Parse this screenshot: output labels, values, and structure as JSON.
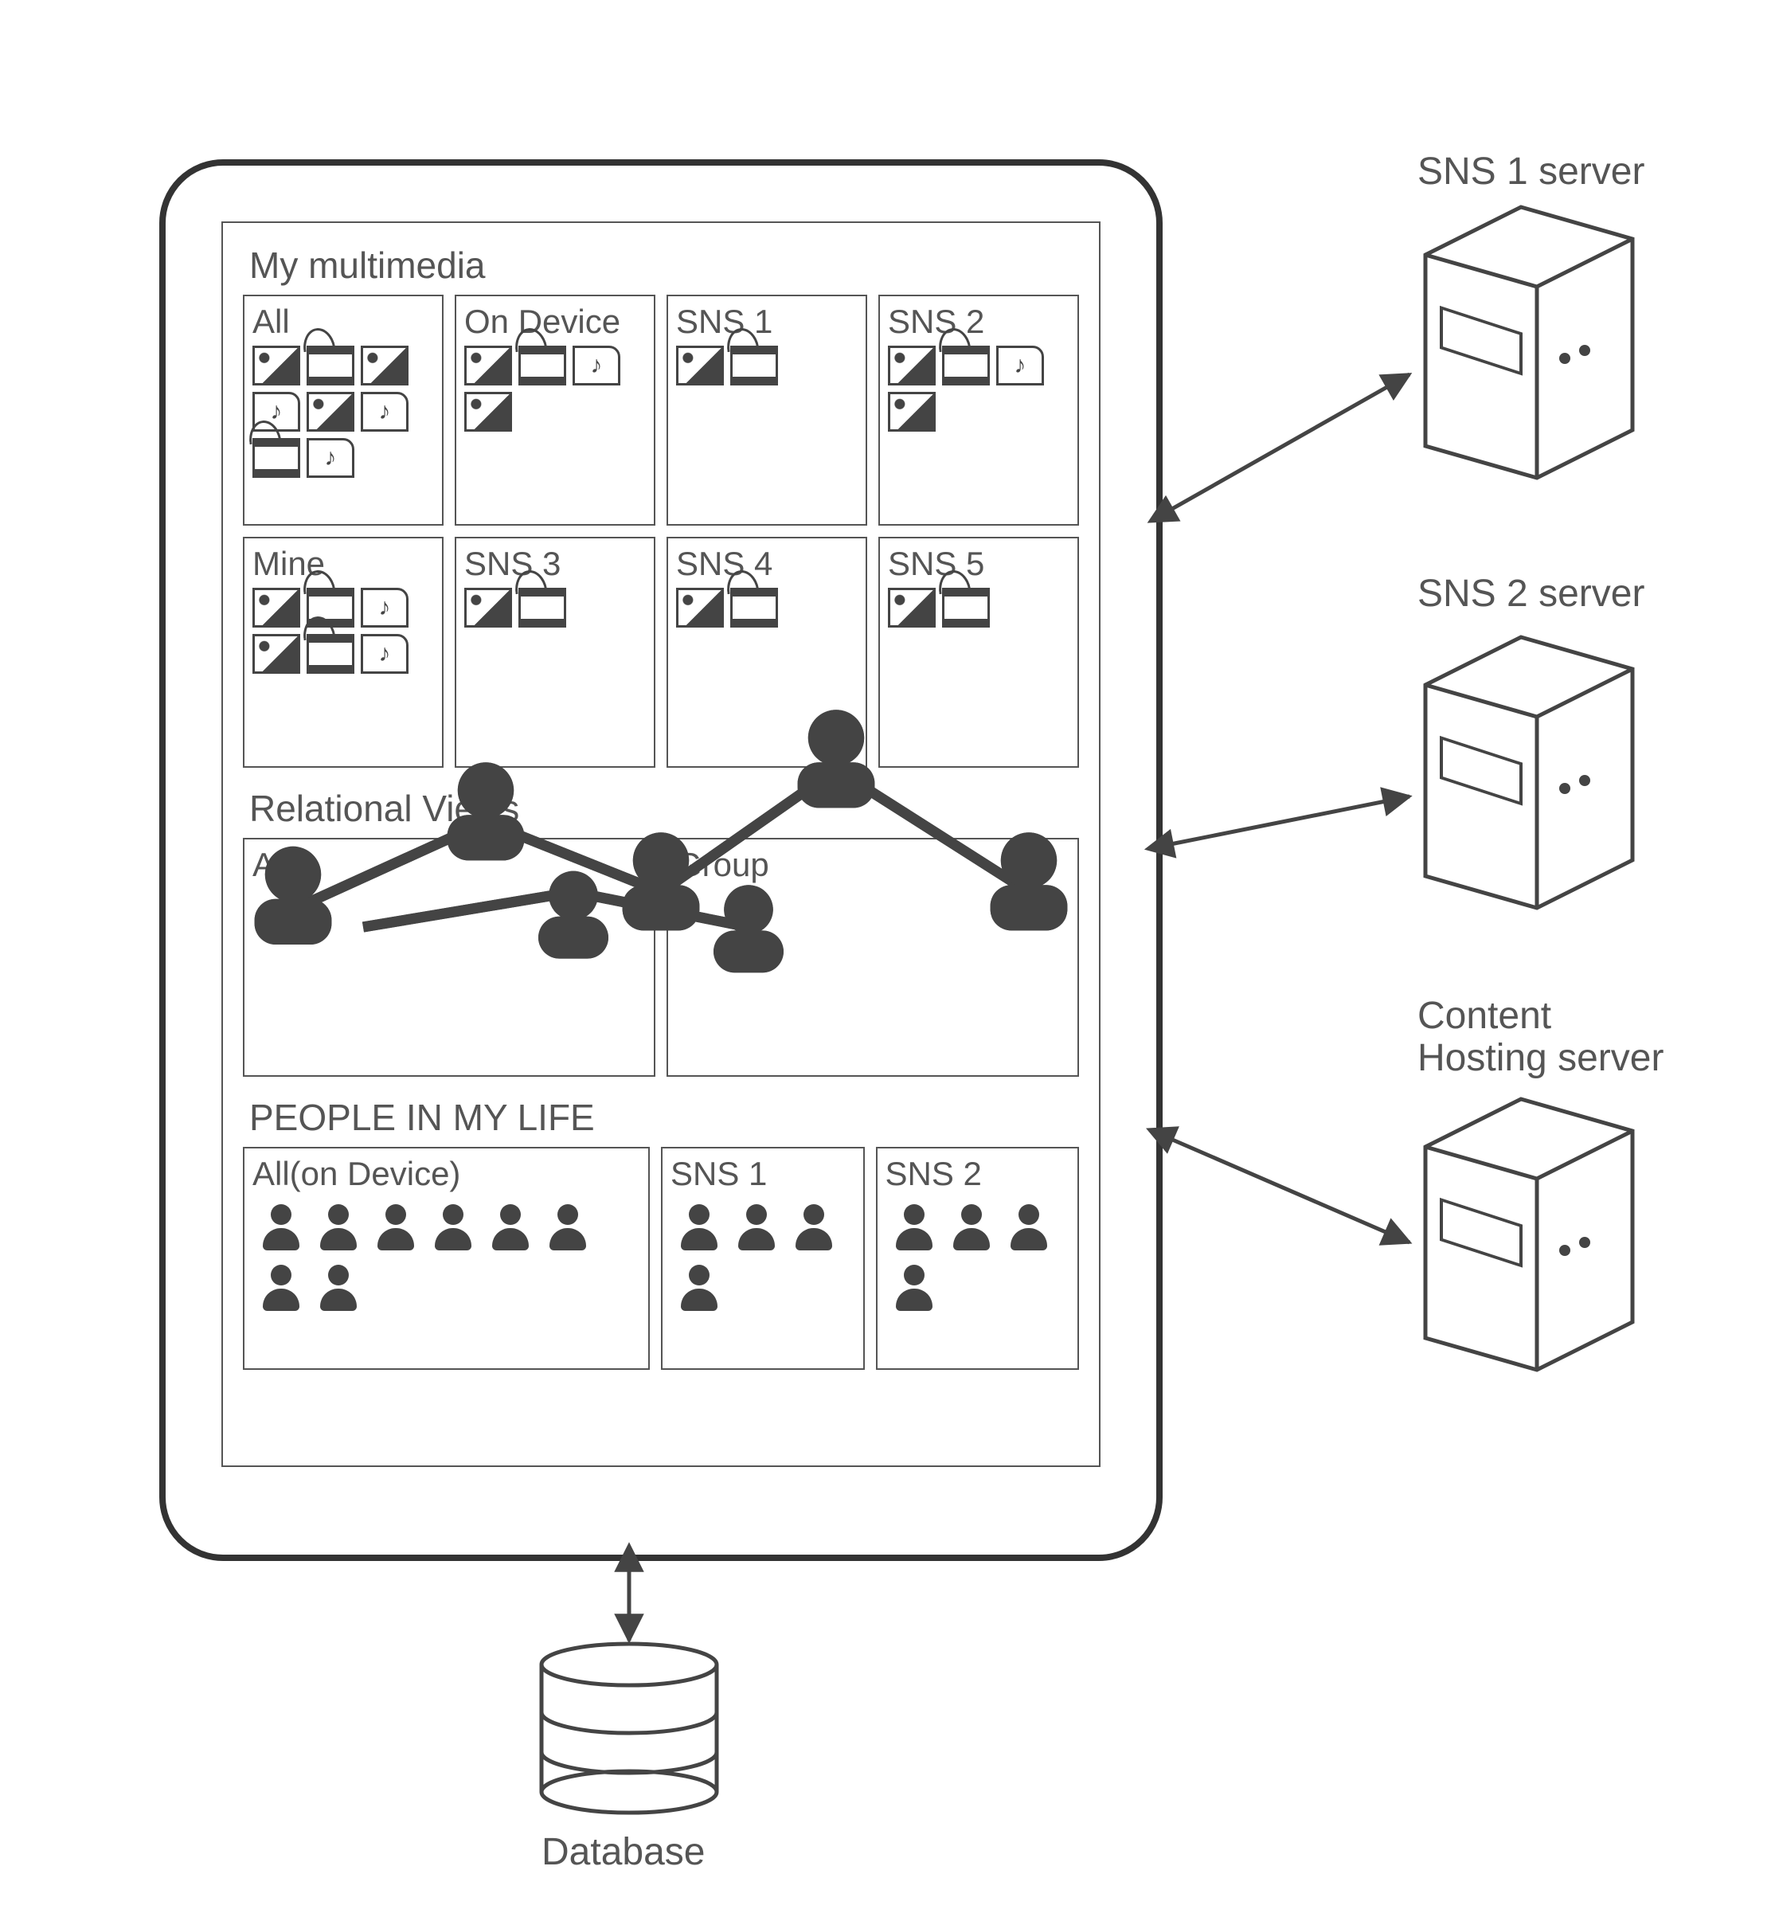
{
  "sections": {
    "multimedia": {
      "title": "My multimedia",
      "tiles": [
        {
          "title": "All",
          "icons": [
            "photo",
            "video",
            "photo",
            "audio",
            "photo",
            "audio",
            "video",
            "audio"
          ]
        },
        {
          "title": "On Device",
          "icons": [
            "photo",
            "video",
            "audio",
            "photo"
          ]
        },
        {
          "title": "SNS 1",
          "icons": [
            "photo",
            "video"
          ]
        },
        {
          "title": "SNS 2",
          "icons": [
            "photo",
            "video",
            "audio",
            "photo"
          ]
        },
        {
          "title": "Mine",
          "icons": [
            "photo",
            "video",
            "audio",
            "photo",
            "video",
            "audio"
          ]
        },
        {
          "title": "SNS 3",
          "icons": [
            "photo",
            "video"
          ]
        },
        {
          "title": "SNS 4",
          "icons": [
            "photo",
            "video"
          ]
        },
        {
          "title": "SNS 5",
          "icons": [
            "photo",
            "video"
          ]
        }
      ]
    },
    "relational": {
      "title": "Relational Views",
      "tiles": [
        {
          "title": "All"
        },
        {
          "title": "Group"
        }
      ]
    },
    "people": {
      "title": "PEOPLE IN MY LIFE",
      "tiles": [
        {
          "title": "All(on Device)",
          "count": 8
        },
        {
          "title": "SNS 1",
          "count": 4
        },
        {
          "title": "SNS 2",
          "count": 4
        }
      ]
    }
  },
  "servers": [
    {
      "label": "SNS 1 server"
    },
    {
      "label": "SNS 2 server"
    },
    {
      "label": "Content\nHosting server"
    }
  ],
  "database_label": "Database"
}
